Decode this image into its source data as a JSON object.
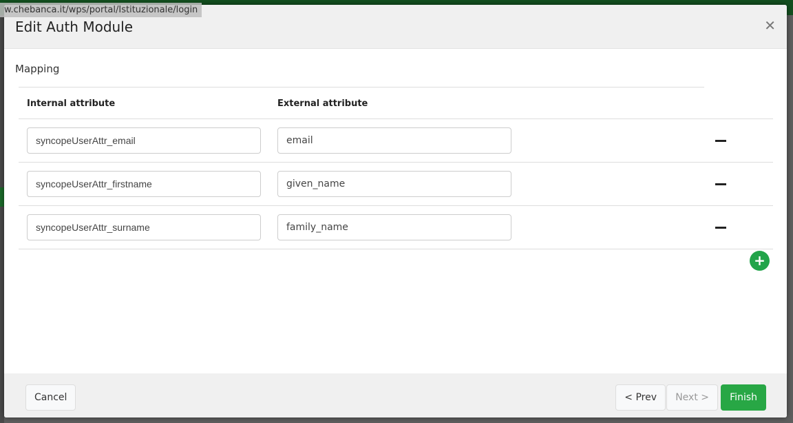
{
  "browser": {
    "status_url": "w.chebanca.it/wps/portal/Istituzionale/login"
  },
  "modal": {
    "title": "Edit Auth Module",
    "close_icon": "close-icon"
  },
  "mapping": {
    "legend": "Mapping",
    "columns": [
      "Internal attribute",
      "External attribute"
    ],
    "rows": [
      {
        "internal": "syncopeUserAttr_email",
        "external": "email"
      },
      {
        "internal": "syncopeUserAttr_firstname",
        "external": "given_name"
      },
      {
        "internal": "syncopeUserAttr_surname",
        "external": "family_name"
      }
    ],
    "add_label": "+"
  },
  "footer": {
    "cancel": "Cancel",
    "prev": "< Prev",
    "next": "Next >",
    "finish": "Finish"
  },
  "colors": {
    "accent": "#28a745"
  }
}
